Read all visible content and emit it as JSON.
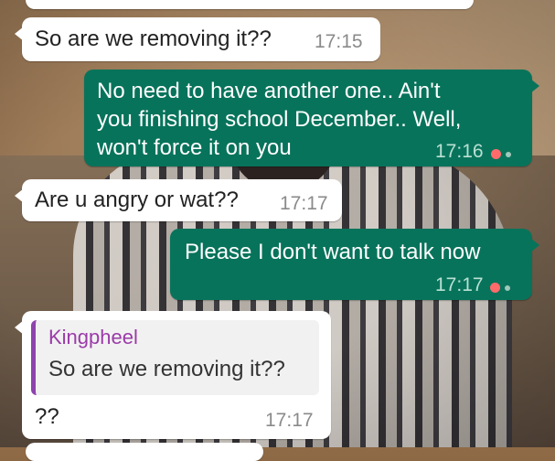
{
  "messages": [
    {
      "id": "m0",
      "direction": "incoming",
      "text": "So are we removing it??",
      "time": "17:15"
    },
    {
      "id": "m1",
      "direction": "outgoing",
      "lines": [
        "No need to have another one.. Ain't",
        "you finishing school December.. Well,",
        "won't force it on you"
      ],
      "time": "17:16"
    },
    {
      "id": "m2",
      "direction": "incoming",
      "text": "Are u angry or wat??",
      "time": "17:17"
    },
    {
      "id": "m3",
      "direction": "outgoing",
      "text": "Please I don't want to talk now",
      "time": "17:17"
    },
    {
      "id": "m4",
      "direction": "incoming",
      "quote": {
        "author": "Kingpheel",
        "text": "So are we removing it??"
      },
      "text": "??",
      "time": "17:17"
    }
  ],
  "colors": {
    "outgoing_bubble": "#08735b",
    "incoming_bubble": "#ffffff",
    "quote_author": "#9b3aa9",
    "quote_bar": "#8e44ad",
    "pending_dot": "#ff6b6b"
  },
  "icons": [
    "status-pending-icon"
  ]
}
